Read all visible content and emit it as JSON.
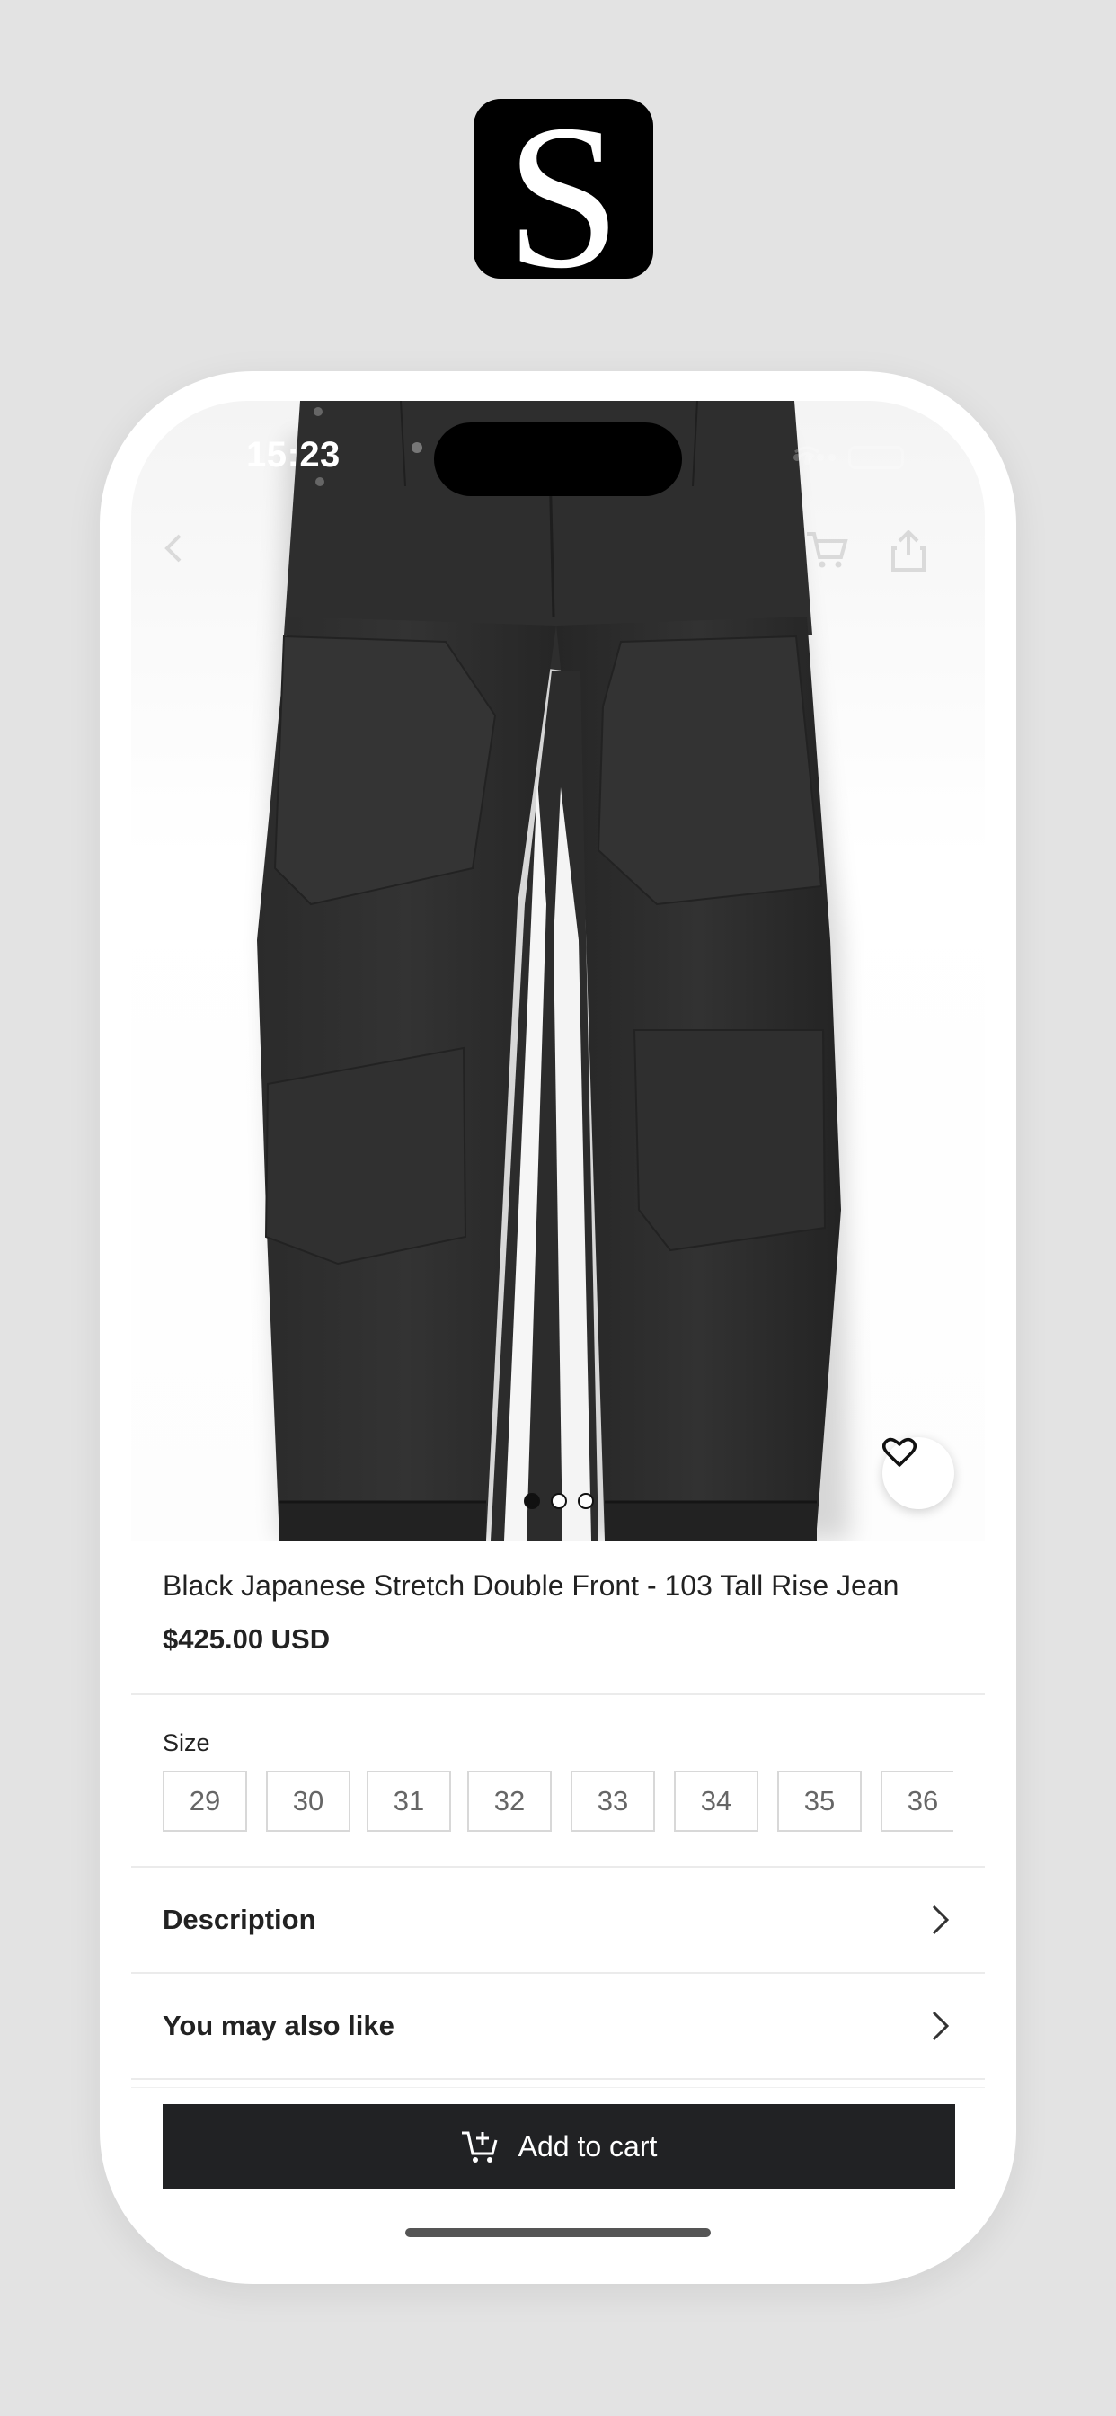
{
  "app_logo": {
    "letter": "S"
  },
  "status_bar": {
    "time": "15:23"
  },
  "product": {
    "title": "Black Japanese Stretch Double Front - 103 Tall Rise Jean",
    "price": "$425.00 USD",
    "image_count": 3,
    "active_image": 1
  },
  "size": {
    "label": "Size",
    "options": [
      "29",
      "30",
      "31",
      "32",
      "33",
      "34",
      "35",
      "36"
    ]
  },
  "sections": {
    "description": "Description",
    "also_like": "You may also like"
  },
  "cart_button": {
    "label": "Add to cart"
  },
  "icons": {
    "back": "chevron-left-icon",
    "cart": "cart-icon",
    "share": "share-icon",
    "favorite": "heart-icon",
    "chevron": "chevron-right-icon",
    "add_cart": "cart-plus-icon"
  },
  "colors": {
    "button": "#212224",
    "garment": "#2a2a2a",
    "background": "#e3e3e3"
  }
}
